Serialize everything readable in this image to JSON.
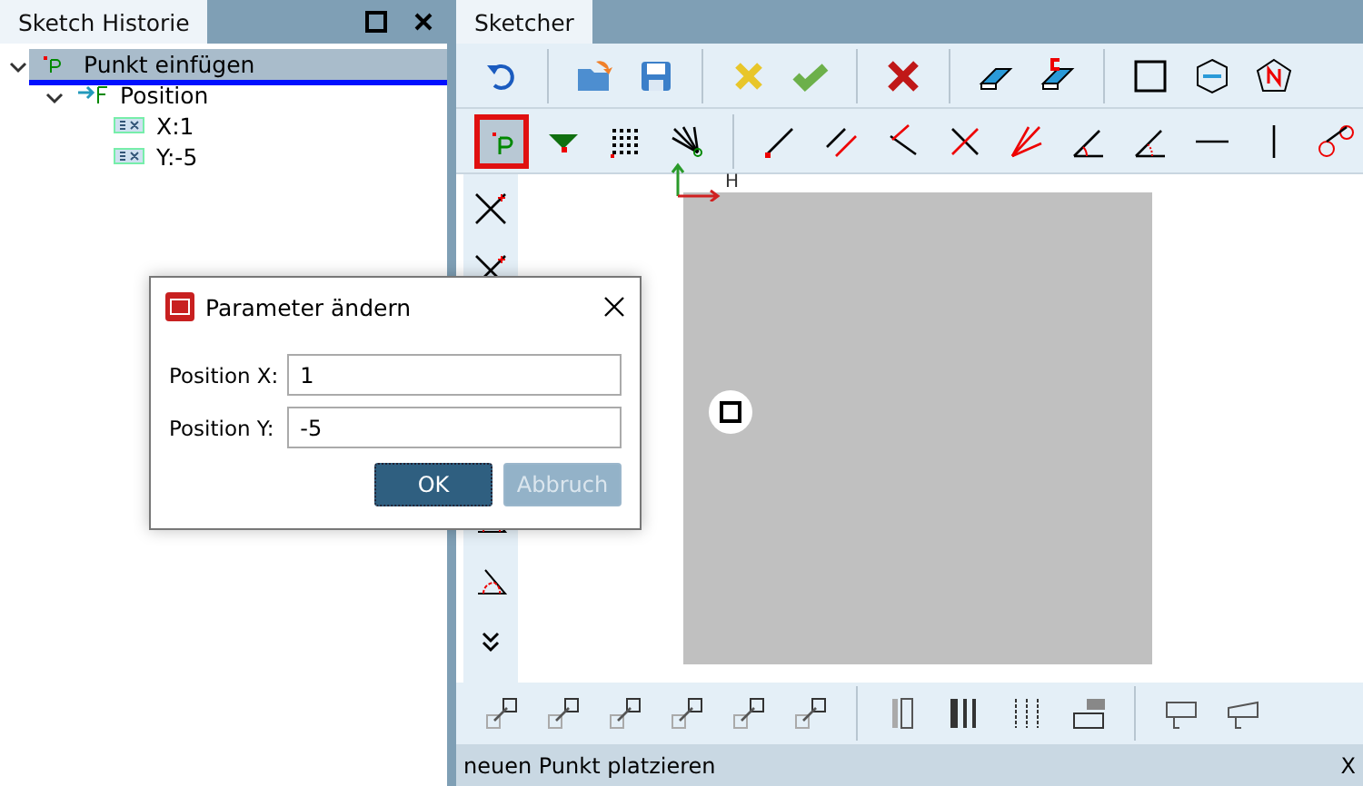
{
  "left_panel": {
    "title": "Sketch Historie"
  },
  "tree": [
    {
      "label": "Punkt einfügen",
      "selected": true,
      "expanded": true,
      "children": [
        {
          "label": "Position",
          "selected": false,
          "expanded": true,
          "children": [
            {
              "label": "X:1",
              "selected": false
            },
            {
              "label": "Y:-5",
              "selected": false
            }
          ]
        }
      ]
    }
  ],
  "right_panel": {
    "tab": "Sketcher"
  },
  "draw_tools": [
    {
      "selected": true
    },
    {
      "selected": false
    },
    {
      "selected": false
    },
    {
      "selected": false
    },
    {
      "selected": false
    },
    {
      "selected": false
    },
    {
      "selected": false
    },
    {
      "selected": false
    },
    {
      "selected": false
    },
    {
      "selected": false
    },
    {
      "selected": false
    },
    {
      "selected": false
    },
    {
      "selected": false
    },
    {
      "selected": false
    }
  ],
  "canvas": {
    "axis_label": "H"
  },
  "dialog": {
    "title": "Parameter ändern",
    "fields": [
      {
        "label": "Position X:",
        "value": "1"
      },
      {
        "label": "Position Y:",
        "value": "-5"
      }
    ],
    "buttons": [
      {
        "label": "OK",
        "disabled": false
      },
      {
        "label": "Abbruch",
        "disabled": true
      }
    ]
  },
  "status_bar": {
    "message": "neuen Punkt platzieren",
    "coord": "X"
  }
}
